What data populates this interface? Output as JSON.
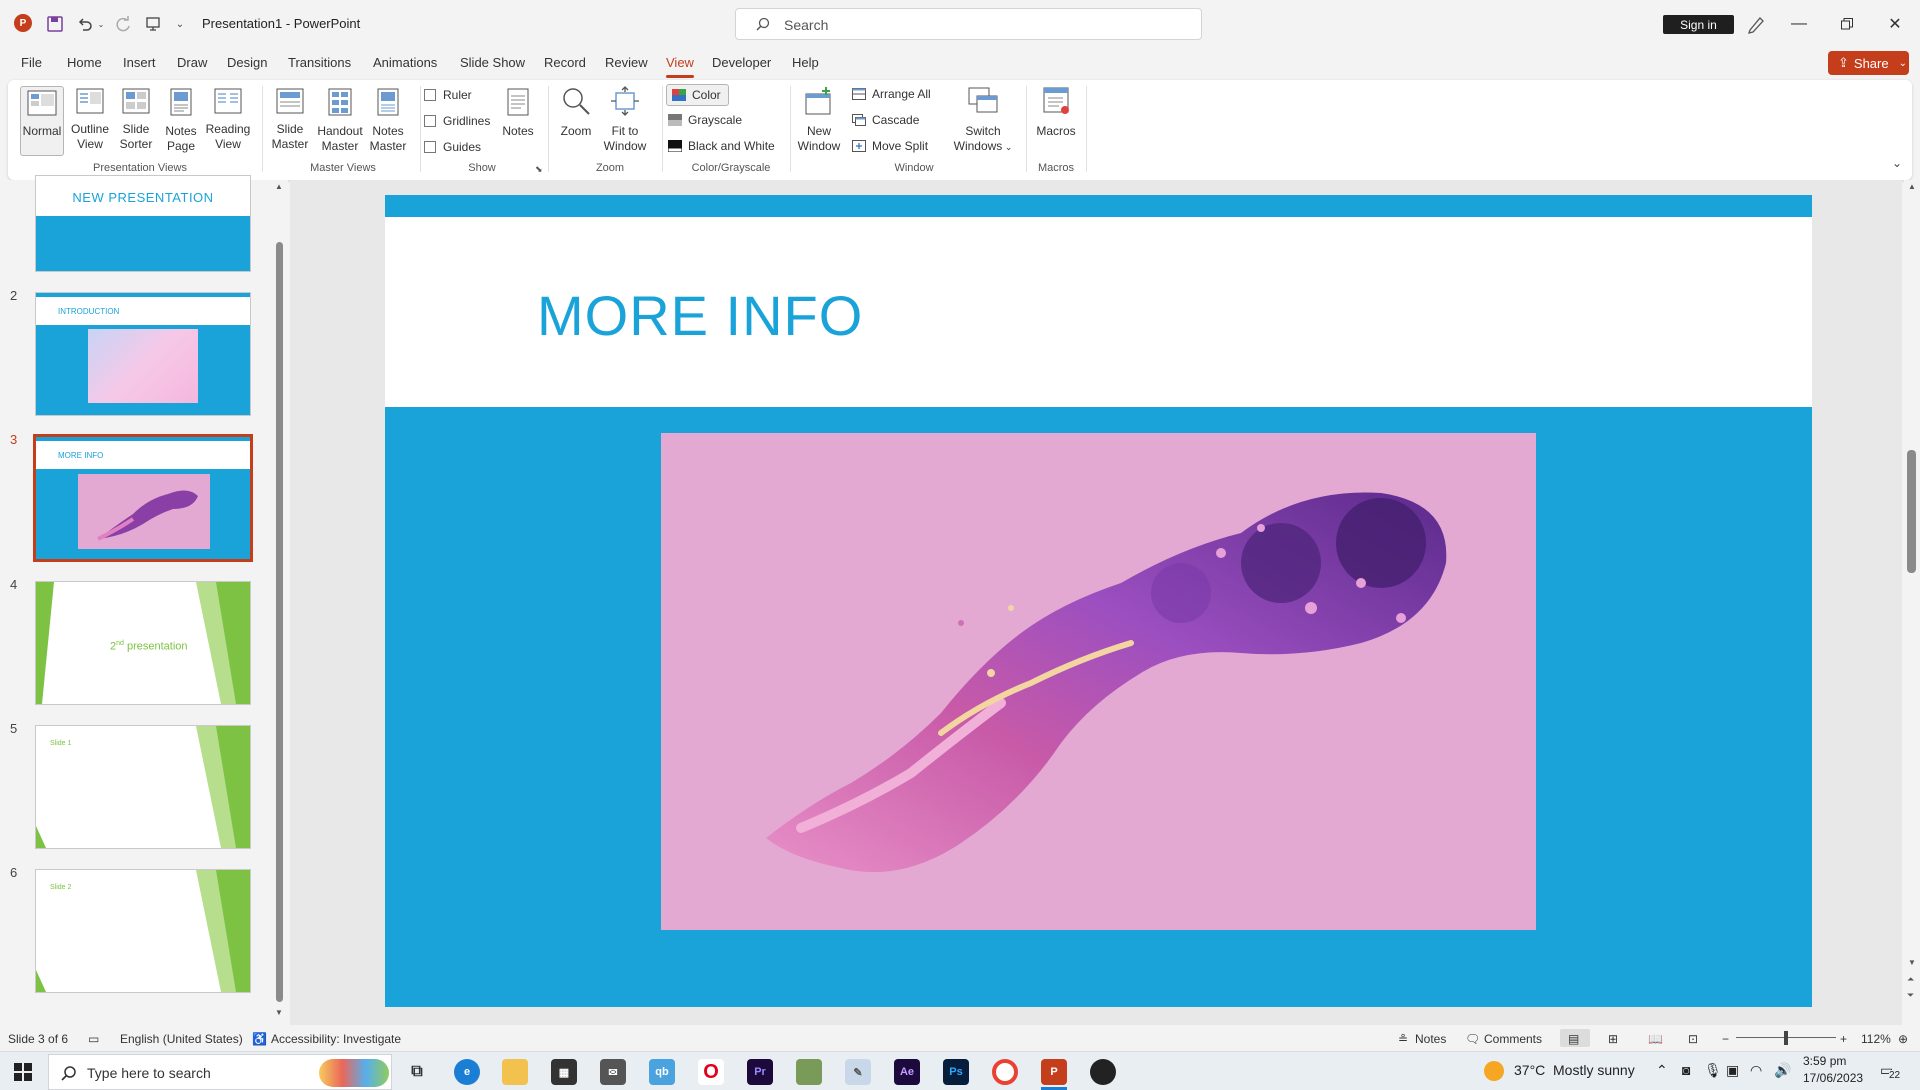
{
  "window": {
    "app_icon": "P",
    "title": "Presentation1  -  PowerPoint",
    "search_placeholder": "Search",
    "sign_in": "Sign in"
  },
  "tabs": [
    "File",
    "Home",
    "Insert",
    "Draw",
    "Design",
    "Transitions",
    "Animations",
    "Slide Show",
    "Record",
    "Review",
    "View",
    "Developer",
    "Help"
  ],
  "active_tab": "View",
  "share_label": "Share",
  "ribbon": {
    "presentation_views": {
      "label": "Presentation Views",
      "normal": "Normal",
      "outline": [
        "Outline",
        "View"
      ],
      "sorter": [
        "Slide",
        "Sorter"
      ],
      "notes_page": [
        "Notes",
        "Page"
      ],
      "reading": [
        "Reading",
        "View"
      ]
    },
    "master_views": {
      "label": "Master Views",
      "slide_master": [
        "Slide",
        "Master"
      ],
      "handout_master": [
        "Handout",
        "Master"
      ],
      "notes_master": [
        "Notes",
        "Master"
      ]
    },
    "show": {
      "label": "Show",
      "ruler": "Ruler",
      "gridlines": "Gridlines",
      "guides": "Guides",
      "notes": "Notes"
    },
    "zoom": {
      "label": "Zoom",
      "zoom": "Zoom",
      "fit": [
        "Fit to",
        "Window"
      ]
    },
    "color": {
      "label": "Color/Grayscale",
      "color": "Color",
      "grayscale": "Grayscale",
      "bw": "Black and White"
    },
    "window": {
      "label": "Window",
      "new_window": [
        "New",
        "Window"
      ],
      "arrange_all": "Arrange All",
      "cascade": "Cascade",
      "move_split": "Move Split",
      "switch": [
        "Switch",
        "Windows"
      ]
    },
    "macros": {
      "label": "Macros",
      "macros": "Macros"
    }
  },
  "thumbnails": [
    {
      "num": "",
      "title": "NEW PRESENTATION"
    },
    {
      "num": "2",
      "title": "INTRODUCTION"
    },
    {
      "num": "3",
      "title": "MORE INFO"
    },
    {
      "num": "4",
      "title_pre": "2",
      "title_sup": "nd",
      "title_post": " presentation"
    },
    {
      "num": "5",
      "title": "Slide 1"
    },
    {
      "num": "6",
      "title": "Slide 2"
    }
  ],
  "selected_slide": 3,
  "slide": {
    "title": "MORE INFO"
  },
  "status": {
    "slide_count": "Slide 3 of 6",
    "language": "English (United States)",
    "accessibility": "Accessibility: Investigate",
    "notes": "Notes",
    "comments": "Comments",
    "zoom_minus": "−",
    "zoom_plus": "+",
    "zoom_level": "112%"
  },
  "taskbar": {
    "search_placeholder": "Type here to search",
    "weather_temp": "37°C",
    "weather_text": "Mostly sunny",
    "time": "3:59 pm",
    "date": "17/06/2023",
    "notification_count": "22"
  },
  "colors": {
    "accent": "#c43e1c",
    "slide_blue": "#1aa3d9",
    "image_pink": "#e3a9d3",
    "green": "#7dc242"
  }
}
